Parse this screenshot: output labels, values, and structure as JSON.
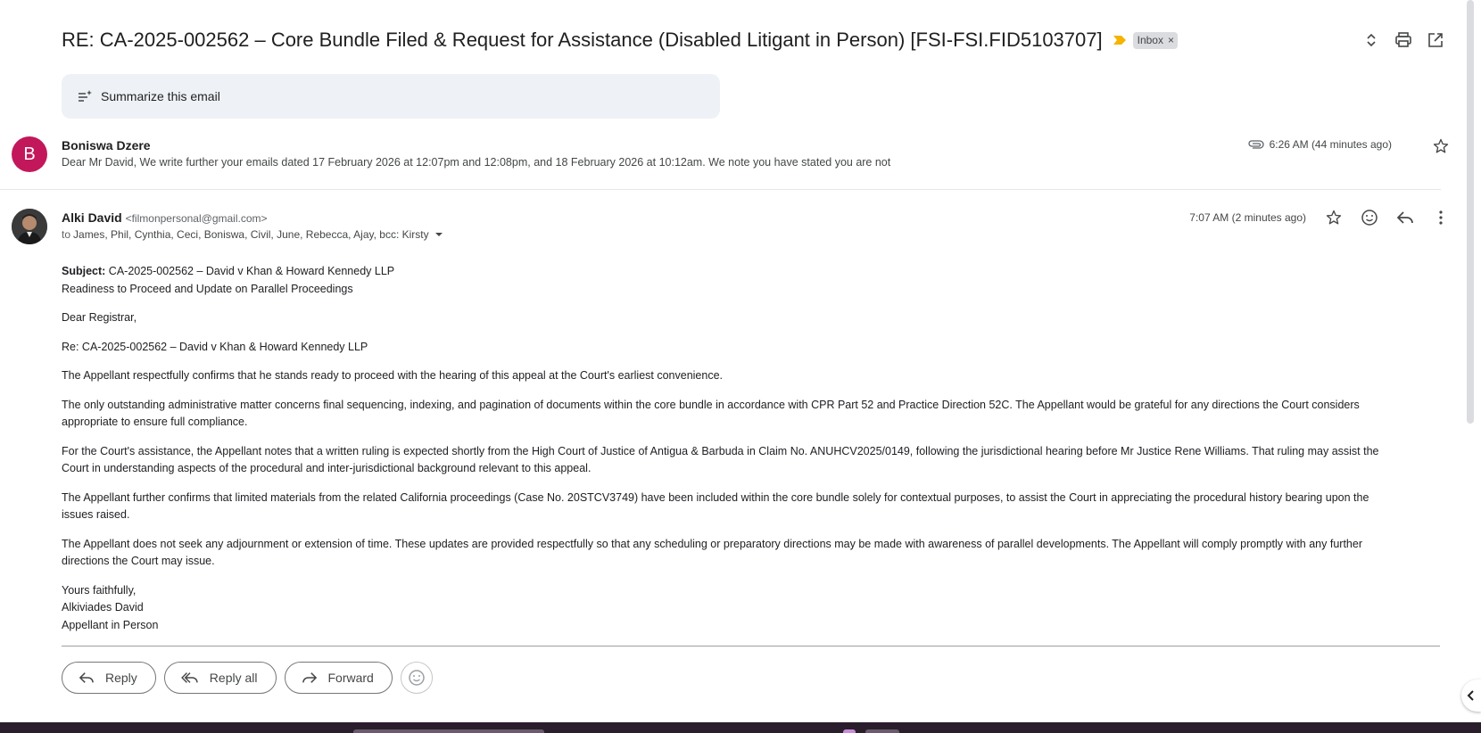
{
  "thread": {
    "subject": "RE: CA-2025-002562 – Core Bundle Filed & Request for Assistance (Disabled Litigant in Person) [FSI-FSI.FID5103707]",
    "label": "Inbox",
    "label_remove": "×",
    "importance_color": "#f4b400"
  },
  "summarize": {
    "label": "Summarize this email"
  },
  "message1": {
    "avatar_letter": "B",
    "avatar_color": "#c2185b",
    "sender": "Boniswa Dzere",
    "snippet": "Dear Mr David, We write further your emails dated 17 February 2026 at 12:07pm and 12:08pm, and 18 February 2026 at 10:12am. We note you have stated you are not",
    "time": "6:26 AM (44 minutes ago)"
  },
  "message2": {
    "sender": "Alki David",
    "email": "<filmonpersonal@gmail.com>",
    "to_prefix": "to",
    "recipients": "James, Phil, Cynthia, Ceci, Boniswa, Civil, June, Rebecca, Ajay, bcc: Kirsty",
    "time": "7:07 AM (2 minutes ago)",
    "body": {
      "subject_label": "Subject:",
      "subject_text": " CA-2025-002562 – David v Khan & Howard Kennedy LLP",
      "subject_line2": "Readiness to Proceed and Update on Parallel Proceedings",
      "salutation": "Dear Registrar,",
      "re_line": "Re: CA-2025-002562 – David v Khan & Howard Kennedy LLP",
      "p1": "The Appellant respectfully confirms that he stands ready to proceed with the hearing of this appeal at the Court's earliest convenience.",
      "p2a": "The only outstanding administrative matter concerns final sequencing, indexing, and pagination of documents within the core bundle in accordance with CPR Part 52 and Practice Direction 52C. The Appellant would be grateful for any directions the Court considers",
      "p2b": "appropriate to ensure full compliance.",
      "p3a": "For the Court's assistance, the Appellant notes that a written ruling is expected shortly from the High Court of Justice of Antigua & Barbuda in Claim No. ANUHCV2025/0149, following the jurisdictional hearing before Mr Justice Rene Williams. That ruling may assist the",
      "p3b": "Court in understanding aspects of the procedural and inter-jurisdictional background relevant to this appeal.",
      "p4a": "The Appellant further confirms that limited materials from the related California proceedings (Case No. 20STCV3749) have been included within the core bundle solely for contextual purposes, to assist the Court in appreciating the procedural history bearing upon the",
      "p4b": "issues raised.",
      "p5a": "The Appellant does not seek any adjournment or extension of time. These updates are provided respectfully so that any scheduling or preparatory directions may be made with awareness of parallel developments. The Appellant will comply promptly with any further",
      "p5b": "directions the Court may issue.",
      "closing": "Yours faithfully,",
      "name": "Alkiviades David",
      "title": "Appellant in Person"
    }
  },
  "actions": {
    "reply": "Reply",
    "reply_all": "Reply all",
    "forward": "Forward"
  }
}
